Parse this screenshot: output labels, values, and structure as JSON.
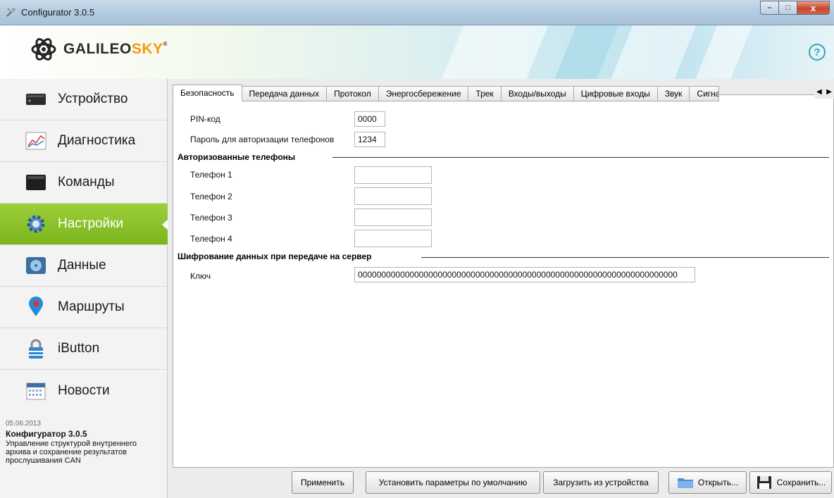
{
  "window": {
    "title": "Configurator 3.0.5",
    "min_glyph": "–",
    "max_glyph": "□",
    "close_glyph": "x"
  },
  "header": {
    "logo_main": "GALILEO",
    "logo_accent": "SKY",
    "logo_reg": "®",
    "help_glyph": "?"
  },
  "sidebar": {
    "items": [
      {
        "label": "Устройство",
        "icon": "device-icon"
      },
      {
        "label": "Диагностика",
        "icon": "chart-icon"
      },
      {
        "label": "Команды",
        "icon": "terminal-icon"
      },
      {
        "label": "Настройки",
        "icon": "gear-icon",
        "active": true
      },
      {
        "label": "Данные",
        "icon": "disk-icon"
      },
      {
        "label": "Маршруты",
        "icon": "map-pin-icon"
      },
      {
        "label": "iButton",
        "icon": "lock-icon"
      },
      {
        "label": "Новости",
        "icon": "calendar-icon"
      }
    ],
    "news": {
      "date": "05.06.2013",
      "title": "Конфигуратор 3.0.5",
      "text": "Управление структурой внутреннего архива и сохранение результатов прослушивания CAN"
    }
  },
  "tabs": [
    "Безопасность",
    "Передача данных",
    "Протокол",
    "Энергосбережение",
    "Трек",
    "Входы/выходы",
    "Цифровые входы",
    "Звук",
    "Сигнали"
  ],
  "security": {
    "pin_label": "PIN-код",
    "pin_value": "0000",
    "password_label": "Пароль для авторизации телефонов",
    "password_value": "1234",
    "phones_section": "Авторизованные телефоны",
    "phones": [
      {
        "label": "Телефон 1",
        "value": ""
      },
      {
        "label": "Телефон 2",
        "value": ""
      },
      {
        "label": "Телефон 3",
        "value": ""
      },
      {
        "label": "Телефон 4",
        "value": ""
      }
    ],
    "encryption_section": "Шифрование данных при передаче на сервер",
    "key_label": "Ключ",
    "key_value": "00000000000000000000000000000000000000000000000000000000000000000000"
  },
  "buttons": {
    "apply": "Применить",
    "defaults": "Установить параметры по умолчанию",
    "load": "Загрузить из устройства",
    "open": "Открыть...",
    "save": "Сохранить..."
  },
  "colors": {
    "active_nav": "#8cc22c",
    "logo_accent": "#f39c0e",
    "help": "#2fa8b8"
  }
}
